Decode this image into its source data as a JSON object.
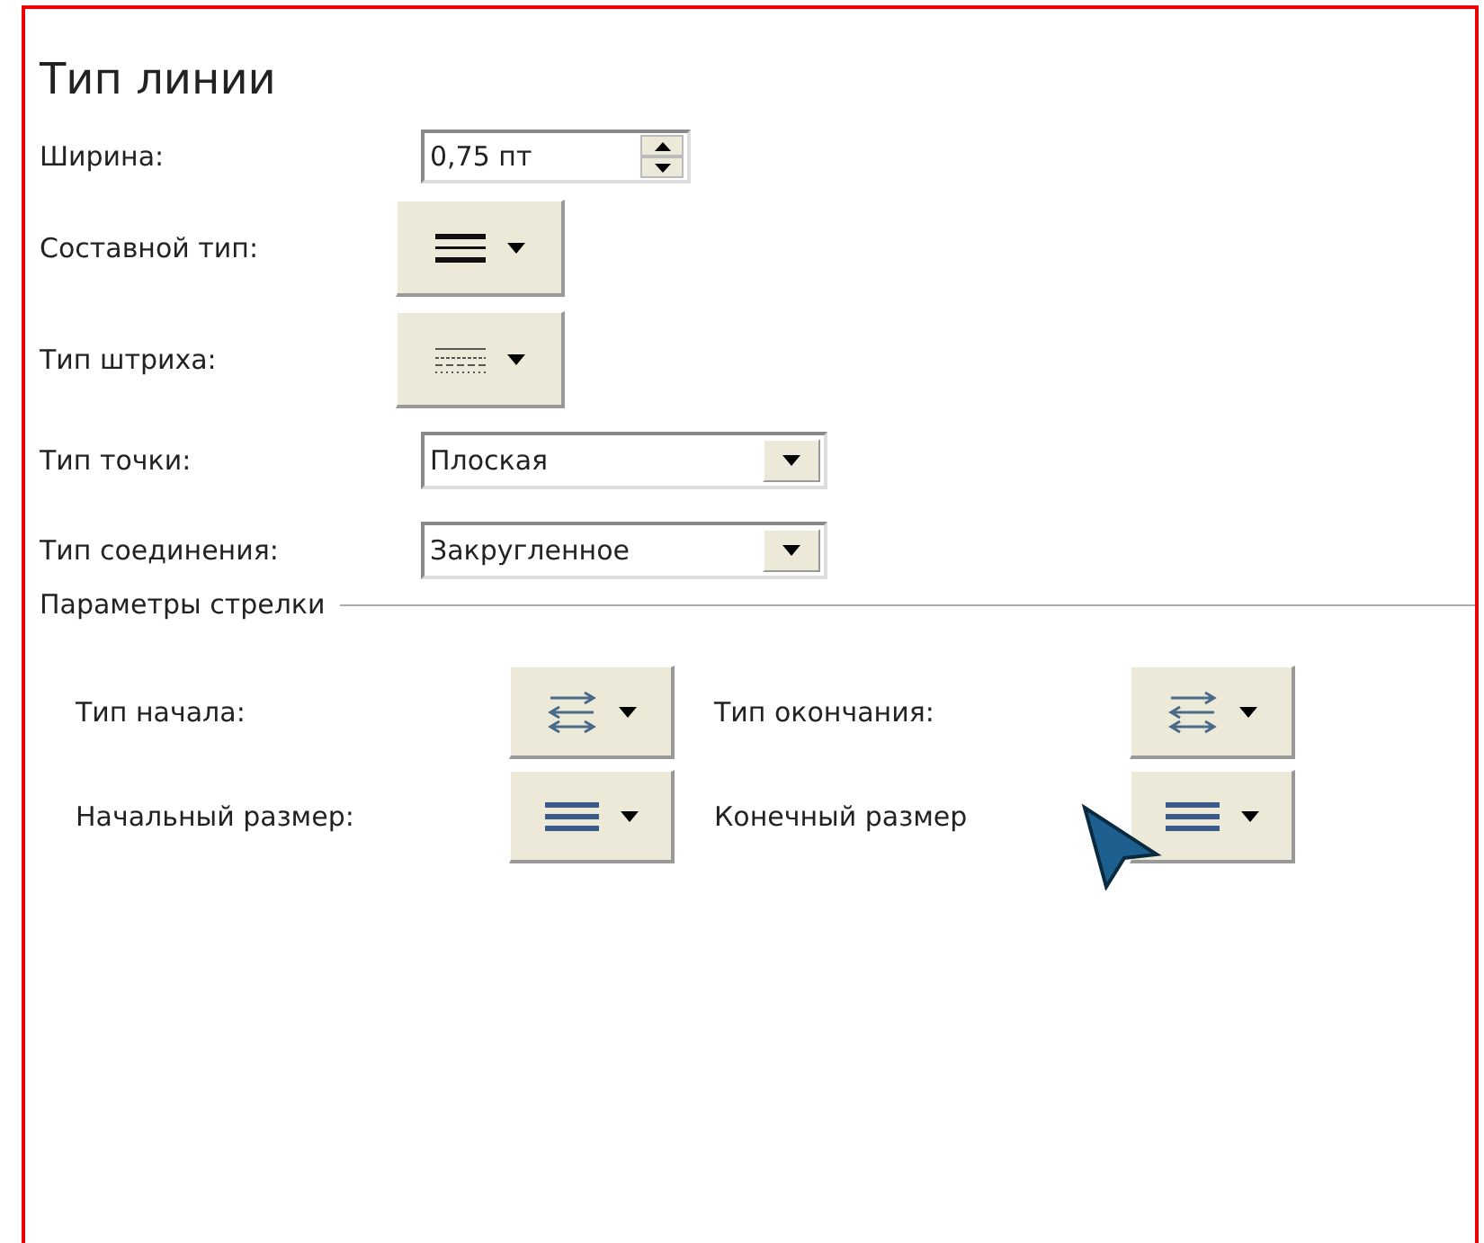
{
  "panel": {
    "title": "Тип линии"
  },
  "fields": [
    {
      "kind": "spinner",
      "label": "Ширина:",
      "value": "0,75 пт"
    },
    {
      "kind": "compound_button",
      "label": "Составной тип:"
    },
    {
      "kind": "dash_button",
      "label": "Тип штриха:"
    },
    {
      "kind": "dropdown",
      "label": "Тип точки:",
      "value": "Плоская"
    },
    {
      "kind": "dropdown",
      "label": "Тип соединения:",
      "value": "Закругленное"
    }
  ],
  "arrow_section": {
    "title": "Параметры стрелки",
    "rows": [
      [
        {
          "label": "Тип начала:",
          "kind": "arrows"
        },
        {
          "label": "Тип окончания:",
          "kind": "arrows"
        }
      ],
      [
        {
          "label": "Начальный размер:",
          "kind": "size"
        },
        {
          "label": "Конечный размер",
          "kind": "size"
        }
      ]
    ]
  }
}
